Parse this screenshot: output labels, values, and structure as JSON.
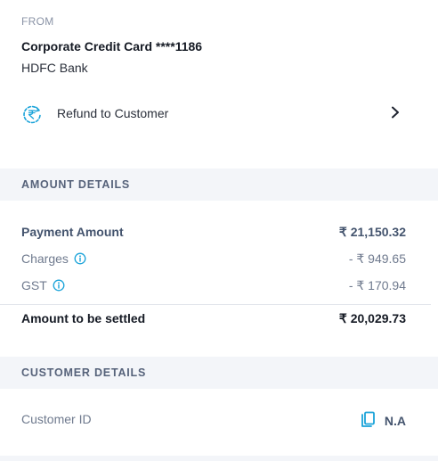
{
  "from": {
    "label": "FROM",
    "card_name": "Corporate Credit Card ****1186",
    "bank": "HDFC Bank"
  },
  "refund": {
    "label": "Refund to Customer",
    "icon": "refund-rupee-icon"
  },
  "amount_details": {
    "heading": "AMOUNT DETAILS",
    "payment_amount": {
      "label": "Payment Amount",
      "value": "₹ 21,150.32"
    },
    "charges": {
      "label": "Charges",
      "value": "- ₹ 949.65"
    },
    "gst": {
      "label": "GST",
      "value": "- ₹ 170.94"
    },
    "settled": {
      "label": "Amount to be settled",
      "value": "₹ 20,029.73"
    }
  },
  "customer_details": {
    "heading": "CUSTOMER DETAILS",
    "customer_id": {
      "label": "Customer ID",
      "value": "N.A"
    }
  },
  "colors": {
    "accent": "#1aa3d9",
    "section_bg": "#f3f5f9",
    "heading_text": "#56627a"
  }
}
